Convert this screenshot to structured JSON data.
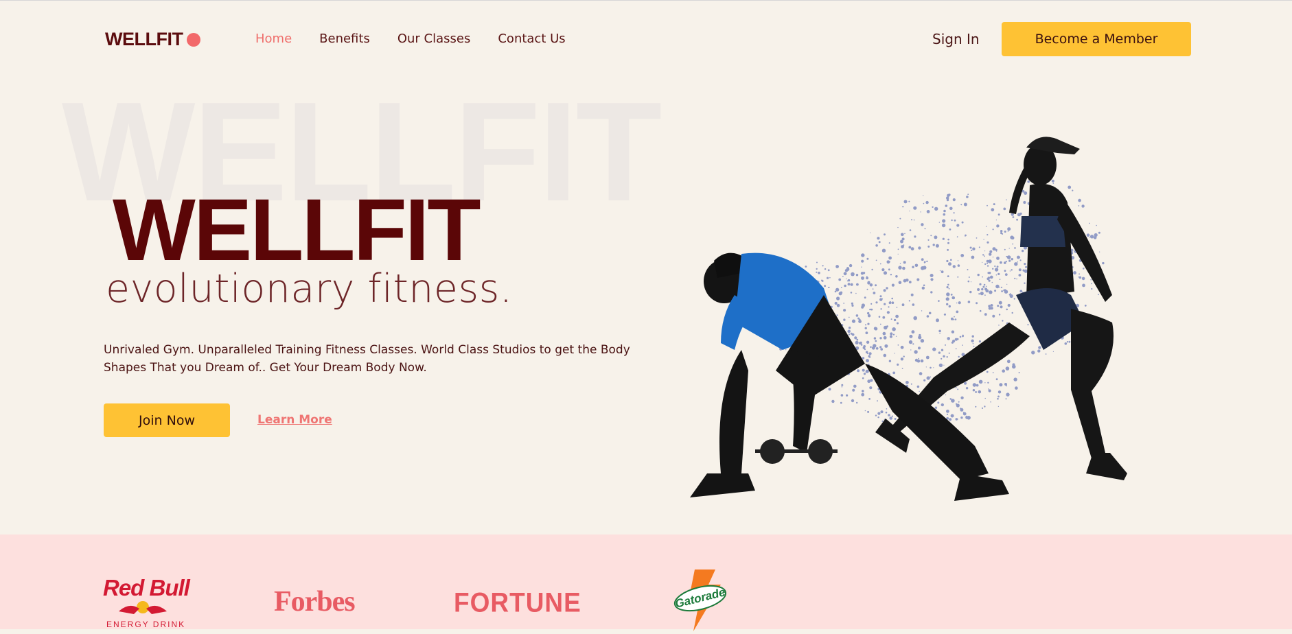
{
  "nav": {
    "logo": "WELLFIT",
    "links": [
      "Home",
      "Benefits",
      "Our Classes",
      "Contact Us"
    ],
    "active": "Home",
    "signin": "Sign In",
    "cta": "Become a Member"
  },
  "hero": {
    "bg_word": "WELLFIT",
    "title": "WELLFIT",
    "subtitle": "evolutionary fitness.",
    "description": "Unrivaled Gym. Unparalleled Training Fitness Classes. World Class Studios to get the Body Shapes That you Dream of.. Get Your Dream Body Now.",
    "primary_button": "Join Now",
    "secondary_link": "Learn More"
  },
  "brands": {
    "redbull": {
      "name": "Red Bull",
      "sub": "ENERGY DRINK"
    },
    "forbes": "Forbes",
    "fortune": "FORTUNE",
    "gatorade": "Gatorade"
  },
  "colors": {
    "background": "#f7f2ea",
    "accent_yellow": "#fec234",
    "accent_coral": "#ef6e6b",
    "brand_maroon": "#5b0607",
    "band_pink": "#fde0de"
  }
}
